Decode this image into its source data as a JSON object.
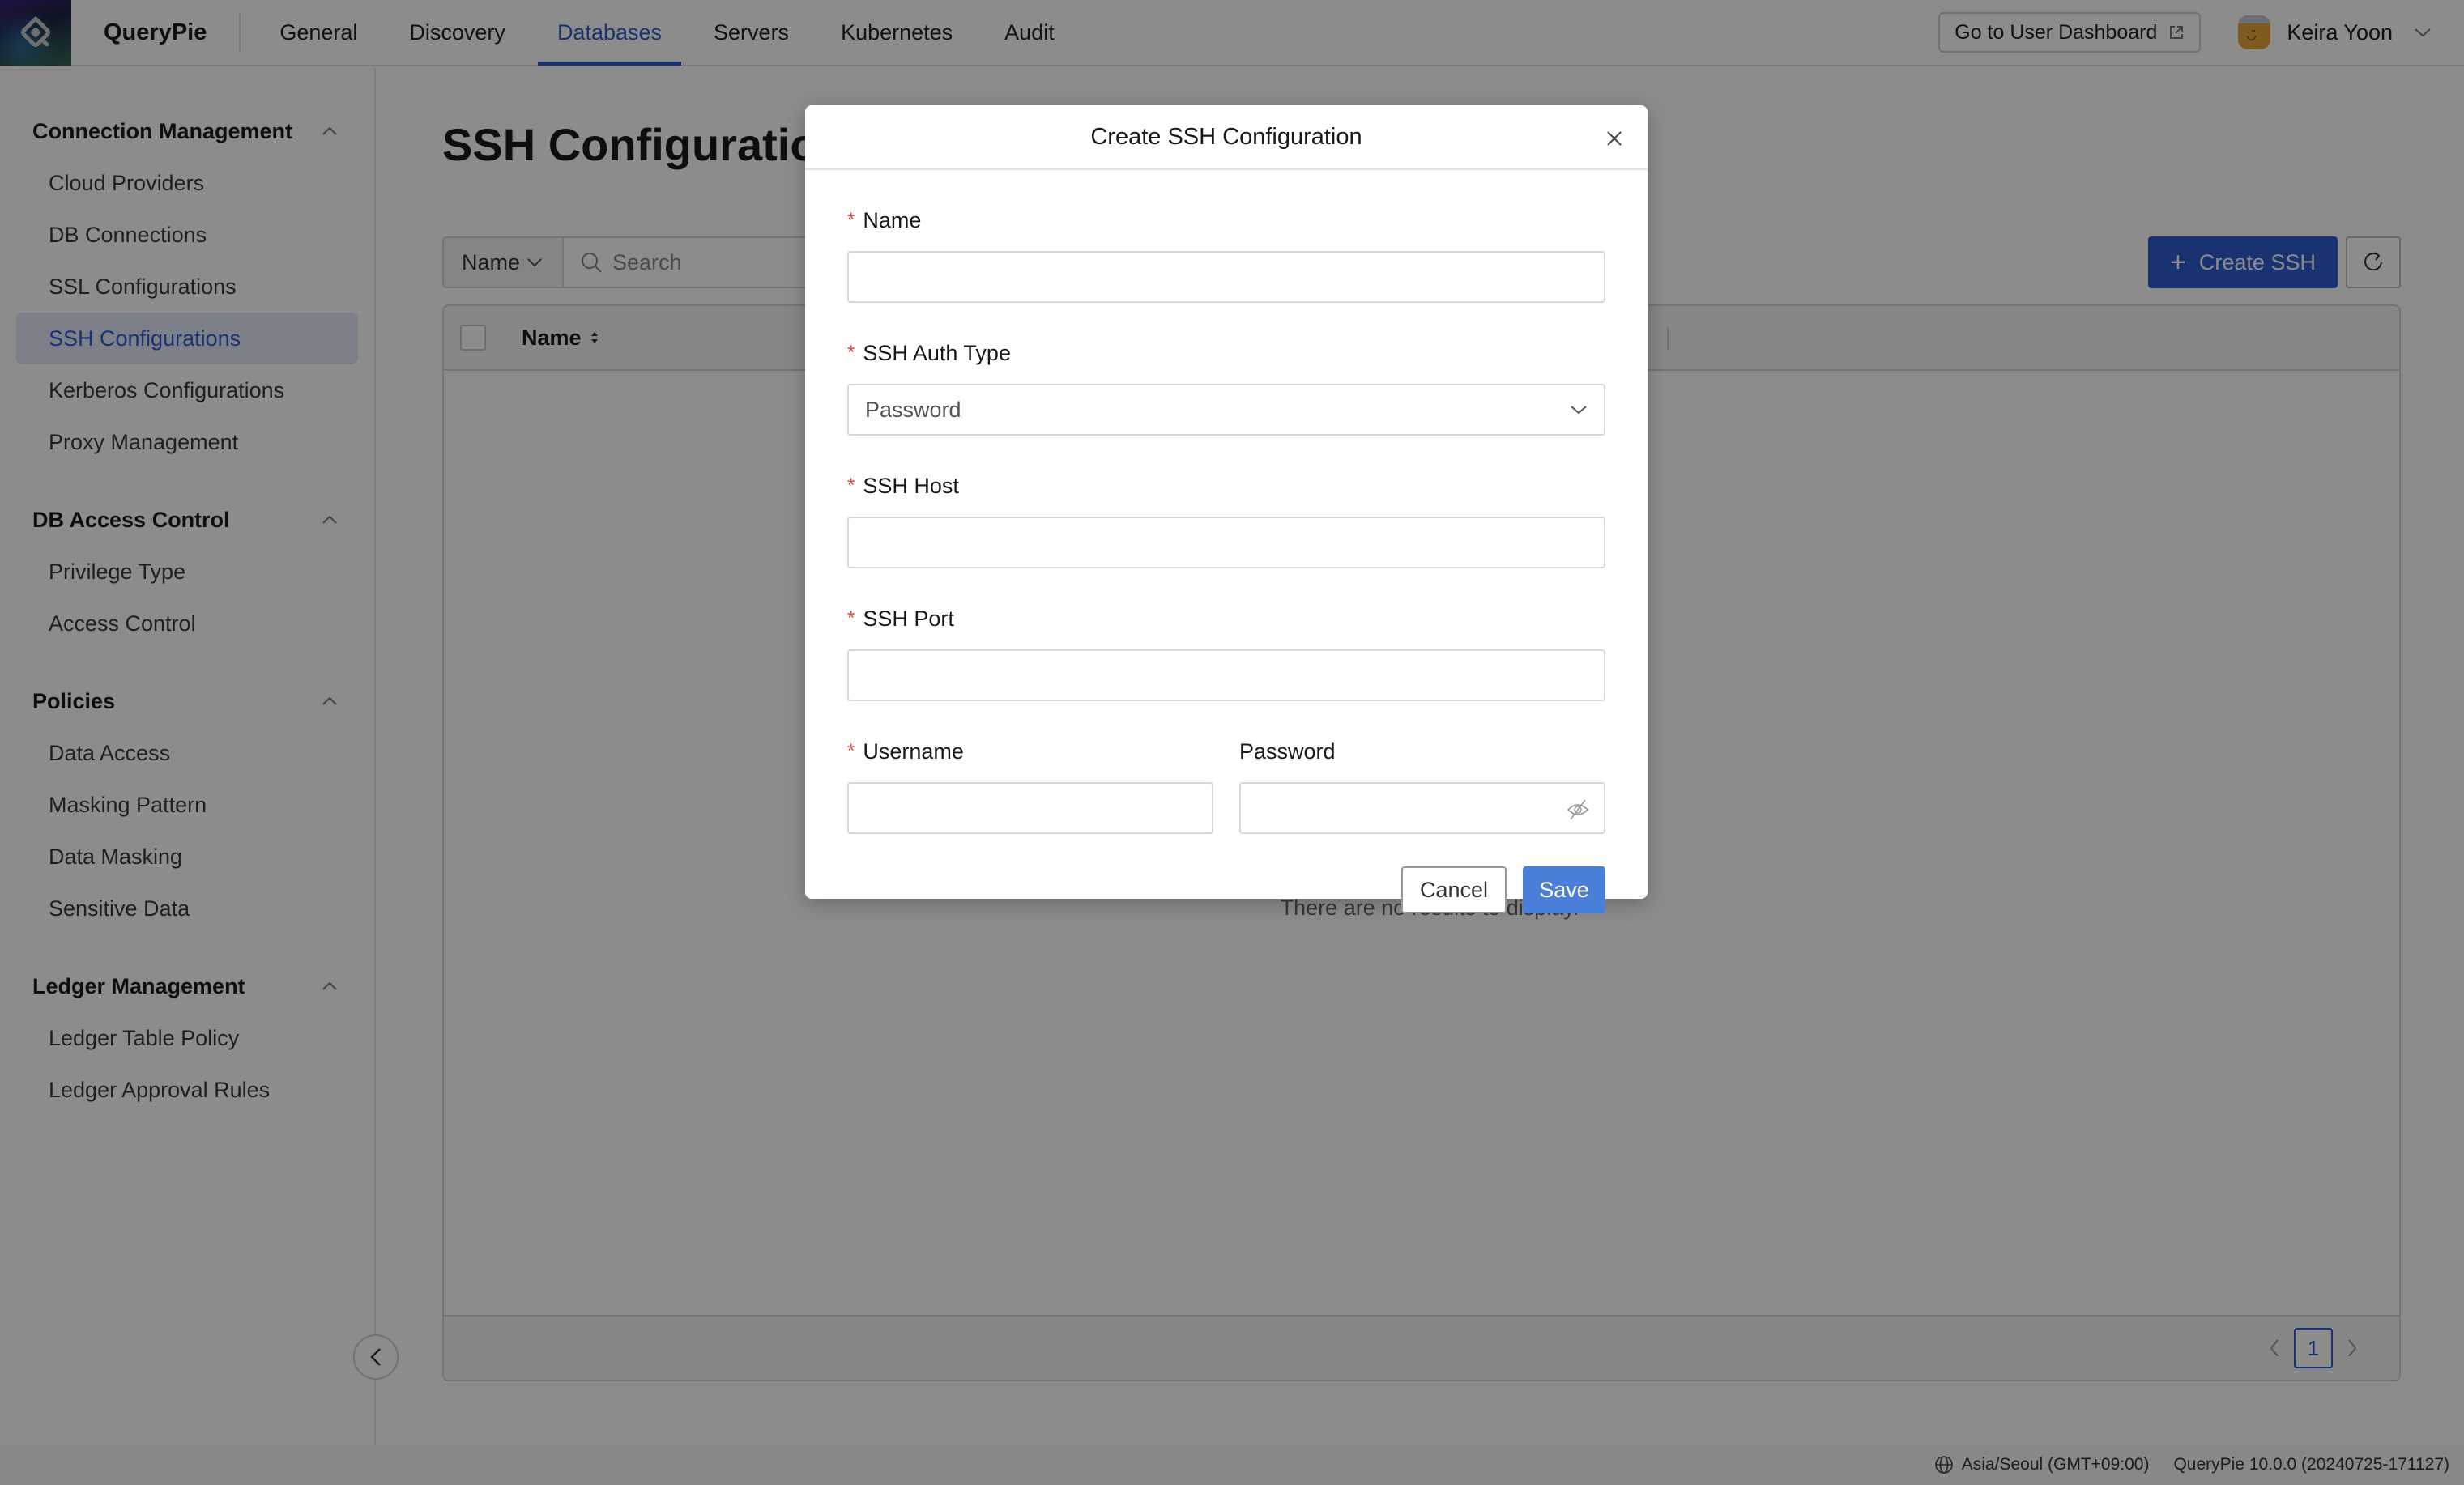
{
  "header": {
    "brand": "QueryPie",
    "nav": [
      {
        "label": "General",
        "active": false
      },
      {
        "label": "Discovery",
        "active": false
      },
      {
        "label": "Databases",
        "active": true
      },
      {
        "label": "Servers",
        "active": false
      },
      {
        "label": "Kubernetes",
        "active": false
      },
      {
        "label": "Audit",
        "active": false
      }
    ],
    "dashboard_button": "Go to User Dashboard",
    "user_name": "Keira Yoon"
  },
  "sidebar": {
    "groups": [
      {
        "title": "Connection Management",
        "items": [
          "Cloud Providers",
          "DB Connections",
          "SSL Configurations",
          "SSH Configurations",
          "Kerberos Configurations",
          "Proxy Management"
        ]
      },
      {
        "title": "DB Access Control",
        "items": [
          "Privilege Type",
          "Access Control"
        ]
      },
      {
        "title": "Policies",
        "items": [
          "Data Access",
          "Masking Pattern",
          "Data Masking",
          "Sensitive Data"
        ]
      },
      {
        "title": "Ledger Management",
        "items": [
          "Ledger Table Policy",
          "Ledger Approval Rules"
        ]
      }
    ],
    "active_item": "SSH Configurations"
  },
  "main": {
    "title": "SSH Configurations",
    "filter_field": "Name",
    "search_placeholder": "Search",
    "create_button": "Create SSH",
    "table": {
      "columns": [
        "Name"
      ],
      "rows": [],
      "empty_message": "There are no results to display."
    },
    "pagination": {
      "current_page": "1"
    }
  },
  "footer": {
    "timezone": "Asia/Seoul (GMT+09:00)",
    "version": "QueryPie 10.0.0 (20240725-171127)"
  },
  "modal": {
    "title": "Create SSH Configuration",
    "fields": {
      "name": {
        "label": "Name",
        "required": true,
        "value": ""
      },
      "auth_type": {
        "label": "SSH Auth Type",
        "required": true,
        "value": "Password"
      },
      "host": {
        "label": "SSH Host",
        "required": true,
        "value": ""
      },
      "port": {
        "label": "SSH Port",
        "required": true,
        "value": ""
      },
      "username": {
        "label": "Username",
        "required": true,
        "value": ""
      },
      "password": {
        "label": "Password",
        "required": false,
        "value": ""
      }
    },
    "required_marker": "*",
    "cancel_button": "Cancel",
    "save_button": "Save"
  },
  "colors": {
    "accent": "#2d5ccf",
    "save_button": "#4a7ed9",
    "required": "#d9473a",
    "overlay": "rgba(0,0,0,0.45)"
  }
}
